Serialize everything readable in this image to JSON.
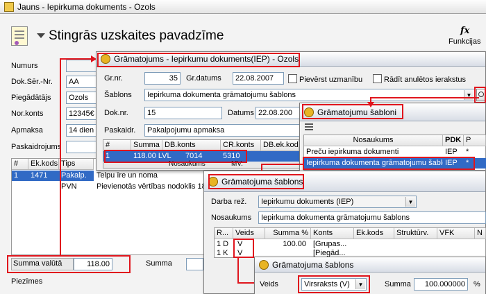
{
  "main": {
    "title": "Jauns - Iepirkuma dokuments - Ozols",
    "heading": "Stingrās uzskaites pavadzīme",
    "functions_label": "Funkcijas",
    "functions_glyph": "fx",
    "fields": {
      "numurs": "Numurs",
      "dok_ser": "Dok.Sēr.-Nr.",
      "dok_ser_val": "AA",
      "piegadatajs": "Piegādātājs",
      "piegadatajs_val": "Ozols",
      "nor_konts": "Nor.konts",
      "nor_konts_val": "12345€",
      "apmaksa": "Apmaksa",
      "apmaksa_val": "14 dien",
      "paskaidrojums": "Paskaidrojums"
    },
    "table": {
      "headers": [
        "#",
        "Ek.kods",
        "Tips"
      ],
      "rows": [
        {
          "n": "1",
          "ek": "1471",
          "tips": "Pakalp.",
          "desc": "Telpu īre un noma"
        },
        {
          "n": "",
          "ek": "",
          "tips": "PVN",
          "desc": "Pievienotās vērtības nodoklis 18"
        }
      ]
    },
    "summa_valuta_label": "Summa valūtā",
    "summa_valuta_val": "118.00",
    "summa_label": "Summa",
    "piezimes_label": "Piezīmes"
  },
  "gramatojums": {
    "title": "Grāmatojums - Iepirkumu dokuments(IEP) - Ozols",
    "gr_nr_label": "Gr.nr.",
    "gr_nr_val": "35",
    "gr_datums_label": "Gr.datums",
    "gr_datums_val": "22.08.2007",
    "pievērst_label": "Pievērst uzmanību",
    "radit_label": "Rādīt anulētos ierakstus",
    "sablons_label": "Šablons",
    "sablons_val": "Iepirkuma dokumenta grāmatojumu šablons",
    "dok_nr_label": "Dok.nr.",
    "dok_nr_val": "15",
    "datums_label": "Datums",
    "datums_val": "22.08.200",
    "paskaidr_label": "Paskaidr.",
    "paskaidr_val": "Pakalpojumu apmaksa",
    "headers": [
      "#",
      "Summa",
      "DB.konts",
      "CR.konts",
      "DB.ek.kod"
    ],
    "row": {
      "n": "1",
      "summa": "118.00 LVL",
      "db": "7014",
      "cr": "5310"
    },
    "partial_header": "Nosaukums",
    "partial_mv": "MV."
  },
  "sabloni": {
    "title": "Grāmatojumu šabloni",
    "headers": [
      "Nosaukums",
      "PDK",
      "P"
    ],
    "rows": [
      {
        "name": "Preču iepirkuma dokumenti",
        "pdk": "IEP",
        "p": "*"
      },
      {
        "name": "Iepirkuma dokumenta grāmatojumu šablon",
        "pdk": "IEP",
        "p": "*"
      }
    ]
  },
  "sablons": {
    "title": "Grāmatojuma šablons",
    "darba_label": "Darba rež.",
    "darba_val": "Iepirkumu dokuments (IEP)",
    "nosaukums_label": "Nosaukums",
    "nosaukums_val": "Iepirkuma dokumenta grāmatojumu šablons",
    "headers": [
      "R...",
      "Veids",
      "Summa %",
      "Konts",
      "Ek.kods",
      "Struktūrv.",
      "VFK",
      "N"
    ],
    "rows": [
      {
        "r": "1 D",
        "veids": "V",
        "summa": "100.00",
        "konts": "[Grupas..."
      },
      {
        "r": "1 K",
        "veids": "V",
        "summa": "",
        "konts": "[Piegād..."
      }
    ]
  },
  "sablons2": {
    "title": "Grāmatojuma šablons",
    "veids_label": "Veids",
    "veids_val": "Virsraksts (V)",
    "summa_label": "Summa",
    "summa_val": "100.000000",
    "pct": "%"
  },
  "colors": {
    "accent": "#e0151d",
    "selection": "#316ac5"
  }
}
